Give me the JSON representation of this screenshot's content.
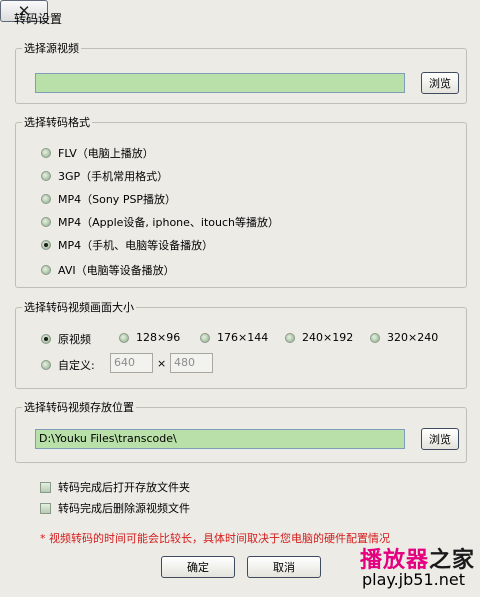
{
  "window": {
    "title": "转码设置",
    "close_glyph": "✕"
  },
  "source": {
    "legend": "选择源视频",
    "value": "",
    "browse_label": "浏览"
  },
  "format": {
    "legend": "选择转码格式",
    "options": [
      {
        "label": "FLV（电脑上播放）",
        "selected": false
      },
      {
        "label": "3GP（手机常用格式）",
        "selected": false
      },
      {
        "label": "MP4（Sony PSP播放）",
        "selected": false
      },
      {
        "label": "MP4（Apple设备, iphone、itouch等播放）",
        "selected": false
      },
      {
        "label": "MP4（手机、电脑等设备播放）",
        "selected": true
      },
      {
        "label": "AVI（电脑等设备播放）",
        "selected": false
      }
    ]
  },
  "size": {
    "legend": "选择转码视频画面大小",
    "options": [
      {
        "label": "原视频",
        "selected": true
      },
      {
        "label": "128×96",
        "selected": false
      },
      {
        "label": "176×144",
        "selected": false
      },
      {
        "label": "240×192",
        "selected": false
      },
      {
        "label": "320×240",
        "selected": false
      }
    ],
    "custom_label": "自定义:",
    "custom_width": "640",
    "custom_height": "480",
    "times": "×"
  },
  "output": {
    "legend": "选择转码视频存放位置",
    "path": "D:\\Youku Files\\transcode\\",
    "browse_label": "浏览"
  },
  "checkboxes": [
    {
      "label": "转码完成后打开存放文件夹",
      "checked": false
    },
    {
      "label": "转码完成后删除源视频文件",
      "checked": false
    }
  ],
  "note": "* 视频转码的时间可能会比较长，具体时间取决于您电脑的硬件配置情况",
  "buttons": {
    "ok": "确定",
    "cancel": "取消"
  },
  "watermark": {
    "part1": "播放器",
    "part2": "之家",
    "url": "play.jb51.net",
    "color1": "#e4007f",
    "color2": "#1a1a1a"
  }
}
